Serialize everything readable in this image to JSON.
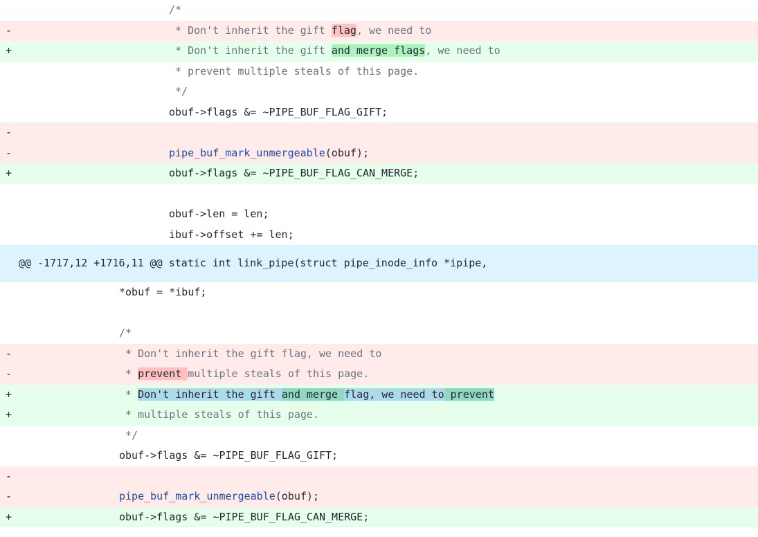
{
  "diff": {
    "colors": {
      "deleted_line_bg": "#ffebe9",
      "added_line_bg": "#e6ffec",
      "deleted_word_bg": "#ffc1c0",
      "added_word_bg": "#abf2bc",
      "hunk_bg": "#ddf4ff",
      "moved_bg": "#aadaeb",
      "function_name": "#1a4ea8",
      "comment_text": "#6a737d"
    },
    "lines": [
      {
        "kind": "context",
        "marker": "",
        "indent": 1,
        "segments": [
          {
            "t": "/*",
            "s": "comment"
          }
        ]
      },
      {
        "kind": "del",
        "marker": "-",
        "indent": 1,
        "segments": [
          {
            "t": " * Don't inherit the gift ",
            "s": "comment"
          },
          {
            "t": "flag",
            "s": "hl-del"
          },
          {
            "t": ", we need to",
            "s": "comment"
          }
        ]
      },
      {
        "kind": "add",
        "marker": "+",
        "indent": 1,
        "segments": [
          {
            "t": " * Don't inherit the gift ",
            "s": "comment"
          },
          {
            "t": "and merge flags",
            "s": "hl-add"
          },
          {
            "t": ", we need to",
            "s": "comment"
          }
        ]
      },
      {
        "kind": "context",
        "marker": "",
        "indent": 1,
        "segments": [
          {
            "t": " * prevent multiple steals of this page.",
            "s": "comment"
          }
        ]
      },
      {
        "kind": "context",
        "marker": "",
        "indent": 1,
        "segments": [
          {
            "t": " */",
            "s": "comment"
          }
        ]
      },
      {
        "kind": "context",
        "marker": "",
        "indent": 1,
        "segments": [
          {
            "t": "obuf->flags &= ~PIPE_BUF_FLAG_GIFT;",
            "s": "code"
          }
        ]
      },
      {
        "kind": "del",
        "marker": "-",
        "indent": 1,
        "segments": []
      },
      {
        "kind": "del",
        "marker": "-",
        "indent": 1,
        "segments": [
          {
            "t": "pipe_buf_mark_unmergeable",
            "s": "fn"
          },
          {
            "t": "(obuf);",
            "s": "code"
          }
        ]
      },
      {
        "kind": "add",
        "marker": "+",
        "indent": 1,
        "segments": [
          {
            "t": "obuf->flags &= ~PIPE_BUF_FLAG_CAN_MERGE;",
            "s": "code"
          }
        ]
      },
      {
        "kind": "context",
        "marker": "",
        "indent": 1,
        "segments": []
      },
      {
        "kind": "context",
        "marker": "",
        "indent": 1,
        "segments": [
          {
            "t": "obuf->len = len;",
            "s": "code"
          }
        ]
      },
      {
        "kind": "context",
        "marker": "",
        "indent": 1,
        "segments": [
          {
            "t": "ibuf->offset += len;",
            "s": "code"
          }
        ]
      },
      {
        "kind": "hunk",
        "text": "@@ -1717,12 +1716,11 @@ static int link_pipe(struct pipe_inode_info *ipipe,"
      },
      {
        "kind": "context",
        "marker": "",
        "indent": 2,
        "segments": [
          {
            "t": "*obuf = *ibuf;",
            "s": "code"
          }
        ]
      },
      {
        "kind": "context",
        "marker": "",
        "indent": 2,
        "segments": []
      },
      {
        "kind": "context",
        "marker": "",
        "indent": 2,
        "segments": [
          {
            "t": "/*",
            "s": "comment"
          }
        ]
      },
      {
        "kind": "del",
        "marker": "-",
        "indent": 2,
        "segments": [
          {
            "t": " * Don't inherit the gift flag, we need to",
            "s": "comment"
          }
        ]
      },
      {
        "kind": "del",
        "marker": "-",
        "indent": 2,
        "segments": [
          {
            "t": " * ",
            "s": "comment"
          },
          {
            "t": "prevent ",
            "s": "hl-del"
          },
          {
            "t": "multiple steals of this page.",
            "s": "comment"
          }
        ]
      },
      {
        "kind": "add",
        "marker": "+",
        "indent": 2,
        "segments": [
          {
            "t": " * ",
            "s": "comment"
          },
          {
            "t": "Don't inherit the gift ",
            "s": "hl-move"
          },
          {
            "t": "and merge ",
            "s": "hl-move-add"
          },
          {
            "t": "flag, we need to",
            "s": "hl-move"
          },
          {
            "t": " prevent",
            "s": "hl-move-add"
          }
        ]
      },
      {
        "kind": "add",
        "marker": "+",
        "indent": 2,
        "segments": [
          {
            "t": " * multiple steals of this page.",
            "s": "comment"
          }
        ]
      },
      {
        "kind": "context",
        "marker": "",
        "indent": 2,
        "segments": [
          {
            "t": " */",
            "s": "comment"
          }
        ]
      },
      {
        "kind": "context",
        "marker": "",
        "indent": 2,
        "segments": [
          {
            "t": "obuf->flags &= ~PIPE_BUF_FLAG_GIFT;",
            "s": "code"
          }
        ]
      },
      {
        "kind": "del",
        "marker": "-",
        "indent": 2,
        "segments": []
      },
      {
        "kind": "del",
        "marker": "-",
        "indent": 2,
        "segments": [
          {
            "t": "pipe_buf_mark_unmergeable",
            "s": "fn"
          },
          {
            "t": "(obuf);",
            "s": "code"
          }
        ]
      },
      {
        "kind": "add",
        "marker": "+",
        "indent": 2,
        "segments": [
          {
            "t": "obuf->flags &= ~PIPE_BUF_FLAG_CAN_MERGE;",
            "s": "code"
          }
        ]
      }
    ]
  }
}
